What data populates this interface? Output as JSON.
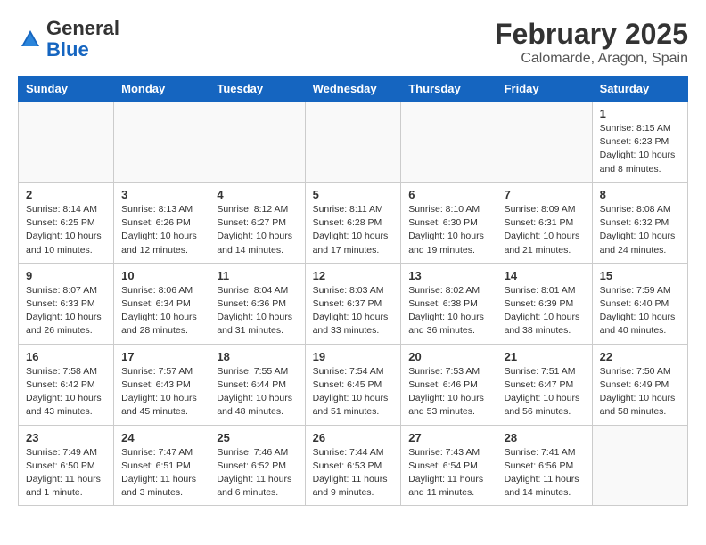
{
  "logo": {
    "general": "General",
    "blue": "Blue"
  },
  "title": "February 2025",
  "location": "Calomarde, Aragon, Spain",
  "weekdays": [
    "Sunday",
    "Monday",
    "Tuesday",
    "Wednesday",
    "Thursday",
    "Friday",
    "Saturday"
  ],
  "weeks": [
    [
      {
        "day": "",
        "info": ""
      },
      {
        "day": "",
        "info": ""
      },
      {
        "day": "",
        "info": ""
      },
      {
        "day": "",
        "info": ""
      },
      {
        "day": "",
        "info": ""
      },
      {
        "day": "",
        "info": ""
      },
      {
        "day": "1",
        "info": "Sunrise: 8:15 AM\nSunset: 6:23 PM\nDaylight: 10 hours and 8 minutes."
      }
    ],
    [
      {
        "day": "2",
        "info": "Sunrise: 8:14 AM\nSunset: 6:25 PM\nDaylight: 10 hours and 10 minutes."
      },
      {
        "day": "3",
        "info": "Sunrise: 8:13 AM\nSunset: 6:26 PM\nDaylight: 10 hours and 12 minutes."
      },
      {
        "day": "4",
        "info": "Sunrise: 8:12 AM\nSunset: 6:27 PM\nDaylight: 10 hours and 14 minutes."
      },
      {
        "day": "5",
        "info": "Sunrise: 8:11 AM\nSunset: 6:28 PM\nDaylight: 10 hours and 17 minutes."
      },
      {
        "day": "6",
        "info": "Sunrise: 8:10 AM\nSunset: 6:30 PM\nDaylight: 10 hours and 19 minutes."
      },
      {
        "day": "7",
        "info": "Sunrise: 8:09 AM\nSunset: 6:31 PM\nDaylight: 10 hours and 21 minutes."
      },
      {
        "day": "8",
        "info": "Sunrise: 8:08 AM\nSunset: 6:32 PM\nDaylight: 10 hours and 24 minutes."
      }
    ],
    [
      {
        "day": "9",
        "info": "Sunrise: 8:07 AM\nSunset: 6:33 PM\nDaylight: 10 hours and 26 minutes."
      },
      {
        "day": "10",
        "info": "Sunrise: 8:06 AM\nSunset: 6:34 PM\nDaylight: 10 hours and 28 minutes."
      },
      {
        "day": "11",
        "info": "Sunrise: 8:04 AM\nSunset: 6:36 PM\nDaylight: 10 hours and 31 minutes."
      },
      {
        "day": "12",
        "info": "Sunrise: 8:03 AM\nSunset: 6:37 PM\nDaylight: 10 hours and 33 minutes."
      },
      {
        "day": "13",
        "info": "Sunrise: 8:02 AM\nSunset: 6:38 PM\nDaylight: 10 hours and 36 minutes."
      },
      {
        "day": "14",
        "info": "Sunrise: 8:01 AM\nSunset: 6:39 PM\nDaylight: 10 hours and 38 minutes."
      },
      {
        "day": "15",
        "info": "Sunrise: 7:59 AM\nSunset: 6:40 PM\nDaylight: 10 hours and 40 minutes."
      }
    ],
    [
      {
        "day": "16",
        "info": "Sunrise: 7:58 AM\nSunset: 6:42 PM\nDaylight: 10 hours and 43 minutes."
      },
      {
        "day": "17",
        "info": "Sunrise: 7:57 AM\nSunset: 6:43 PM\nDaylight: 10 hours and 45 minutes."
      },
      {
        "day": "18",
        "info": "Sunrise: 7:55 AM\nSunset: 6:44 PM\nDaylight: 10 hours and 48 minutes."
      },
      {
        "day": "19",
        "info": "Sunrise: 7:54 AM\nSunset: 6:45 PM\nDaylight: 10 hours and 51 minutes."
      },
      {
        "day": "20",
        "info": "Sunrise: 7:53 AM\nSunset: 6:46 PM\nDaylight: 10 hours and 53 minutes."
      },
      {
        "day": "21",
        "info": "Sunrise: 7:51 AM\nSunset: 6:47 PM\nDaylight: 10 hours and 56 minutes."
      },
      {
        "day": "22",
        "info": "Sunrise: 7:50 AM\nSunset: 6:49 PM\nDaylight: 10 hours and 58 minutes."
      }
    ],
    [
      {
        "day": "23",
        "info": "Sunrise: 7:49 AM\nSunset: 6:50 PM\nDaylight: 11 hours and 1 minute."
      },
      {
        "day": "24",
        "info": "Sunrise: 7:47 AM\nSunset: 6:51 PM\nDaylight: 11 hours and 3 minutes."
      },
      {
        "day": "25",
        "info": "Sunrise: 7:46 AM\nSunset: 6:52 PM\nDaylight: 11 hours and 6 minutes."
      },
      {
        "day": "26",
        "info": "Sunrise: 7:44 AM\nSunset: 6:53 PM\nDaylight: 11 hours and 9 minutes."
      },
      {
        "day": "27",
        "info": "Sunrise: 7:43 AM\nSunset: 6:54 PM\nDaylight: 11 hours and 11 minutes."
      },
      {
        "day": "28",
        "info": "Sunrise: 7:41 AM\nSunset: 6:56 PM\nDaylight: 11 hours and 14 minutes."
      },
      {
        "day": "",
        "info": ""
      }
    ]
  ]
}
